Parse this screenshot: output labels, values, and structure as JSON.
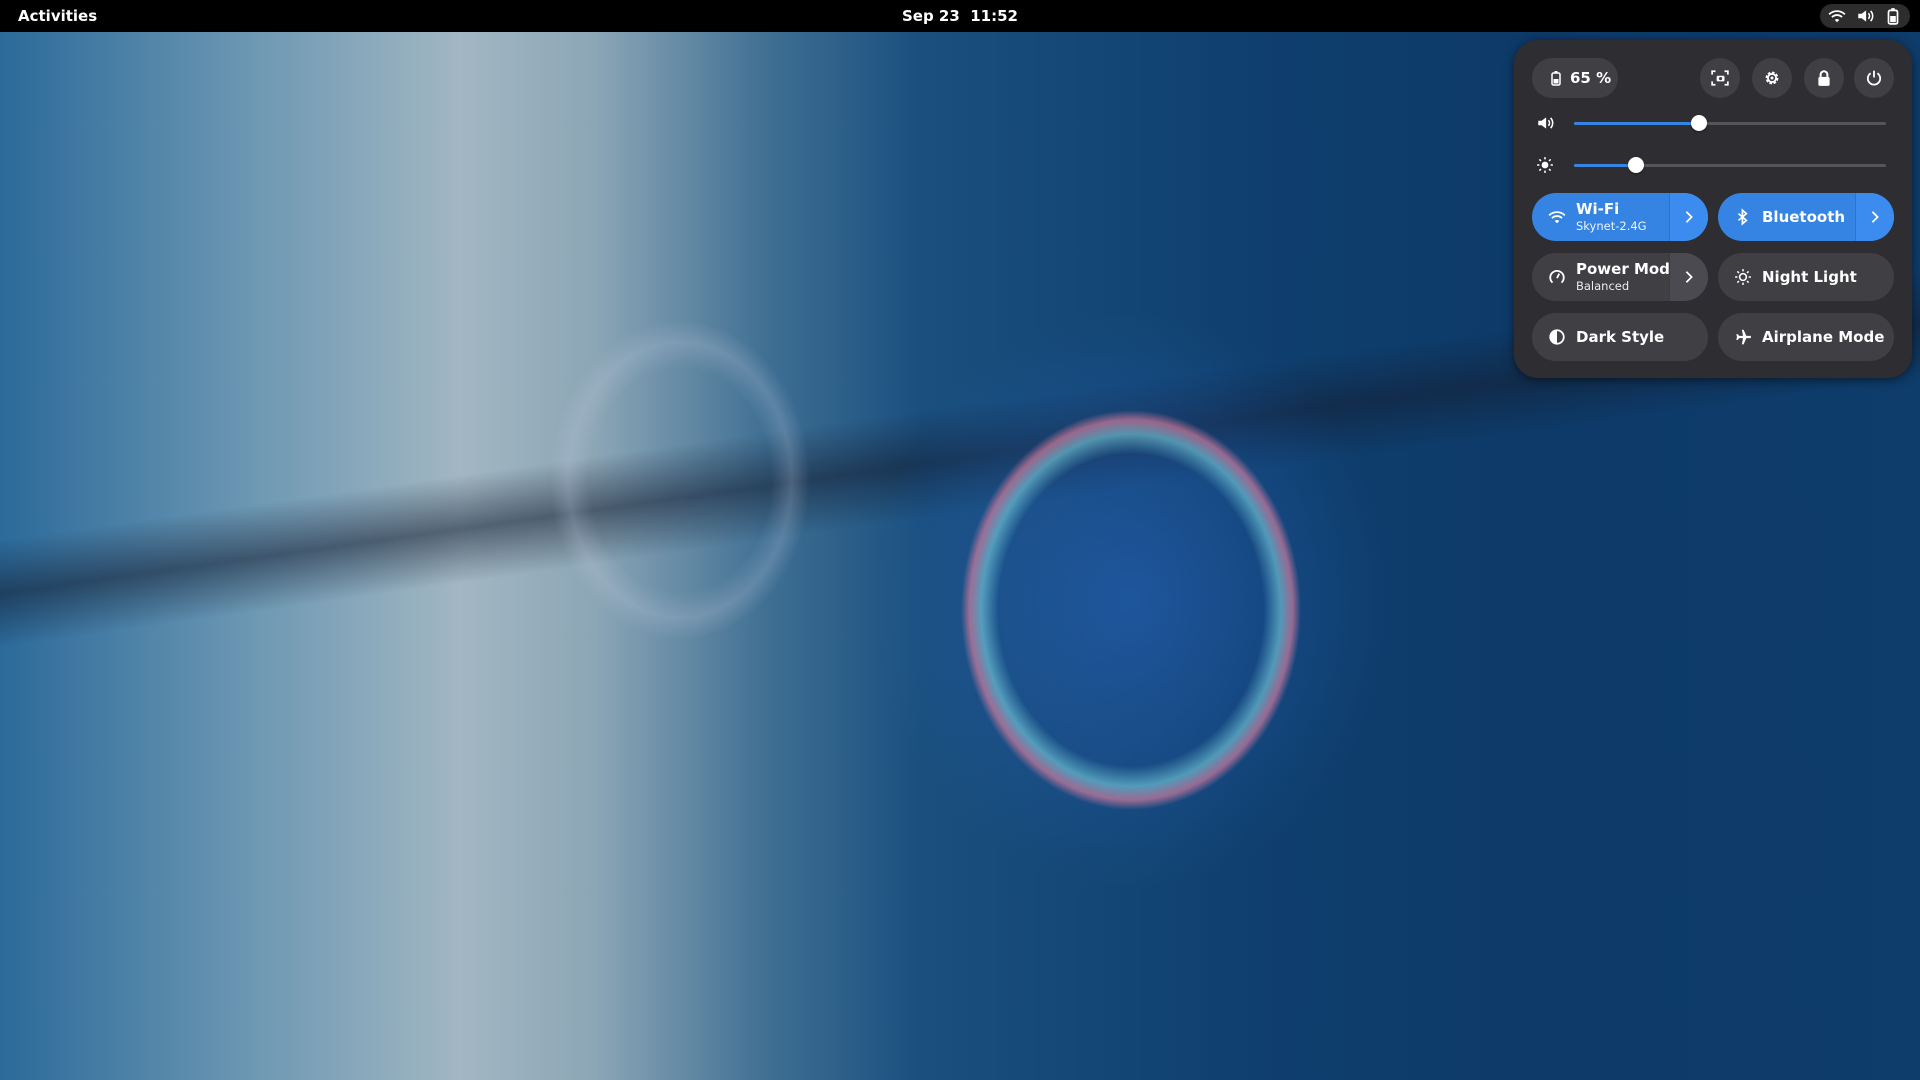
{
  "topbar": {
    "activities_label": "Activities",
    "date": "Sep 23",
    "time": "11:52",
    "tray_icons": [
      "wifi-icon",
      "volume-icon",
      "battery-icon"
    ]
  },
  "quick_settings": {
    "battery_label": "65 %",
    "buttons": [
      "screenshot-icon",
      "gear-icon",
      "lock-icon",
      "power-icon"
    ],
    "volume": {
      "icon": "volume-icon",
      "level": 0.4
    },
    "brightness": {
      "icon": "brightness-icon",
      "level": 0.2
    },
    "tiles": {
      "wifi": {
        "title": "Wi-Fi",
        "subtitle": "Skynet-2.4G",
        "active": true
      },
      "bluetooth": {
        "title": "Bluetooth",
        "active": true
      },
      "power_mode": {
        "title": "Power Mode",
        "subtitle": "Balanced",
        "active": false
      },
      "night_light": {
        "title": "Night Light",
        "active": false
      },
      "dark_style": {
        "title": "Dark Style",
        "active": false
      },
      "airplane_mode": {
        "title": "Airplane Mode",
        "active": false
      }
    }
  },
  "colors": {
    "accent": "#3584e4",
    "panel_bg": "#2e2e32",
    "tile_bg": "#3f3f44"
  }
}
